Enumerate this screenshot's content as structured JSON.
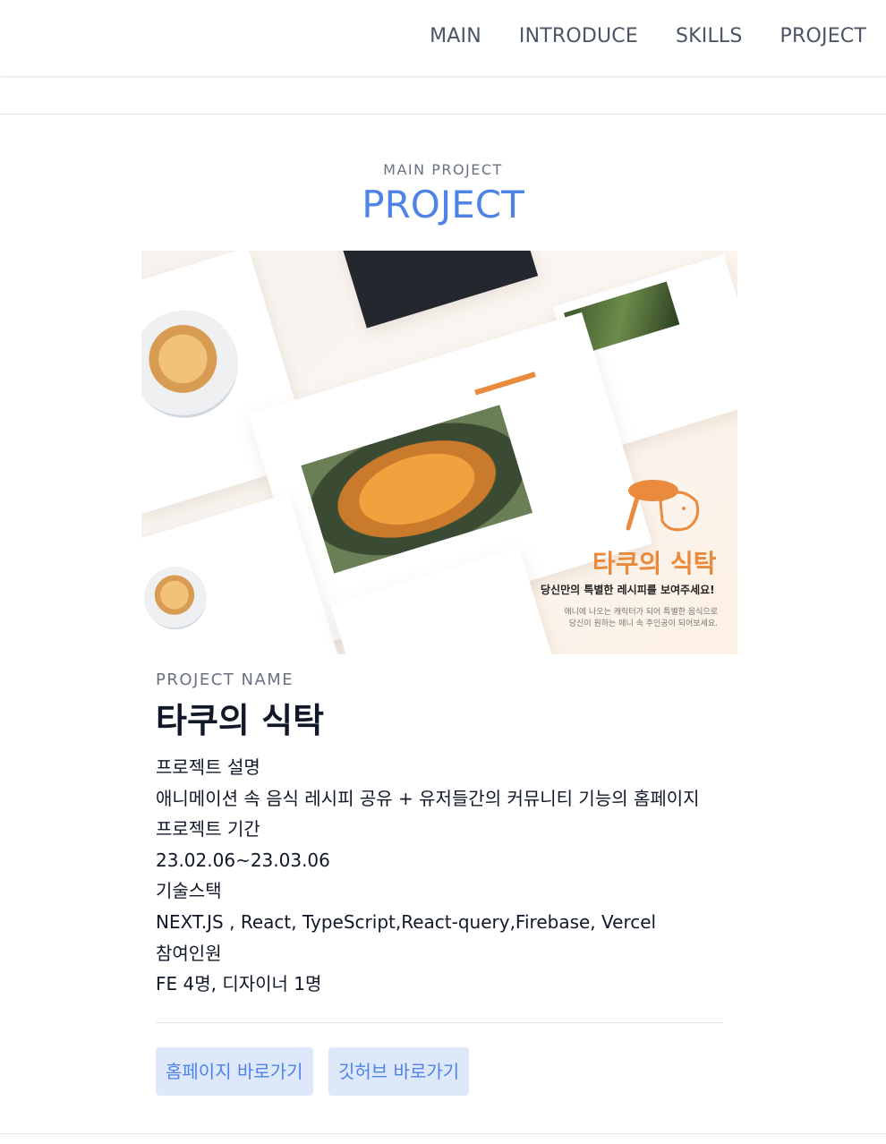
{
  "nav": {
    "items": [
      {
        "label": "MAIN"
      },
      {
        "label": "INTRODUCE"
      },
      {
        "label": "SKILLS"
      },
      {
        "label": "PROJECT"
      }
    ]
  },
  "section": {
    "eyebrow": "MAIN PROJECT",
    "title": "PROJECT"
  },
  "hero": {
    "brand_title": "타쿠의 식탁",
    "brand_subtitle": "당신만의 특별한 레시피를 보여주세요!",
    "brand_desc_1": "애니에 나오는 캐릭터가 되어 특별한 음식으로",
    "brand_desc_2": "당신이 원하는 애니 속 주인공이 되어보세요.",
    "accent_color": "#e98a3c"
  },
  "project": {
    "eyebrow": "PROJECT NAME",
    "name": "타쿠의 식탁",
    "desc_label": "프로젝트 설명",
    "desc_value": "애니메이션 속 음식 레시피 공유 + 유저들간의 커뮤니티 기능의 홈페이지",
    "period_label": "프로젝트 기간",
    "period_value": "23.02.06~23.03.06",
    "stack_label": "기술스택",
    "stack_value": "NEXT.JS , React, TypeScript,React-query,Firebase, Vercel",
    "members_label": "참여인원",
    "members_value": "FE 4명, 디자이너 1명"
  },
  "buttons": {
    "homepage": "홈페이지 바로가기",
    "github": "깃허브 바로가기"
  },
  "colors": {
    "accent": "#4f83e6",
    "button_bg": "#dde8fb"
  }
}
